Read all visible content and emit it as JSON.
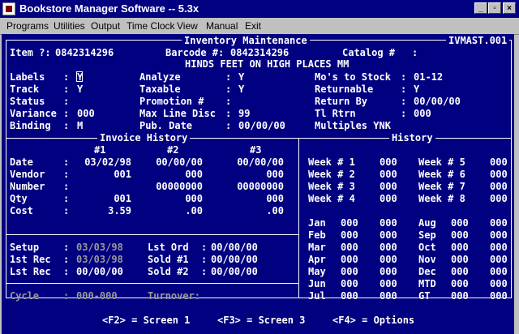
{
  "window": {
    "title": "Bookstore Manager Software -- 5.3x",
    "controls": {
      "minimize": "_",
      "maximize": "▫",
      "close": "×"
    }
  },
  "menu": [
    "Programs",
    "Utilities",
    "Output",
    "Time Clock",
    "View",
    "Manual",
    "Exit"
  ],
  "header": {
    "screen_title": "Inventory Maintenance",
    "screen_code": "IVMAST.001",
    "item_label": "Item ?:",
    "item_value": "0842314296",
    "barcode_label": "Barcode #:",
    "barcode_value": "0842314296",
    "catalog_label": "Catalog #",
    "catalog_value": ":",
    "book_title": "HINDS FEET ON HIGH PLACES MM"
  },
  "fields": {
    "labels": {
      "label": "Labels",
      "value": "Y"
    },
    "track": {
      "label": "Track",
      "value": "Y"
    },
    "status": {
      "label": "Status",
      "value": ""
    },
    "variance": {
      "label": "Variance",
      "value": "000"
    },
    "binding": {
      "label": "Binding",
      "value": "M"
    },
    "analyze": {
      "label": "Analyze",
      "value": "Y"
    },
    "taxable": {
      "label": "Taxable",
      "value": "Y"
    },
    "promotion": {
      "label": "Promotion #",
      "value": ""
    },
    "max_line_disc": {
      "label": "Max Line Disc",
      "value": "99"
    },
    "pub_date": {
      "label": "Pub. Date",
      "value": "00/00/00"
    },
    "mos_to_stock": {
      "label": "Mo's to Stock",
      "value": "01-12"
    },
    "returnable": {
      "label": "Returnable",
      "value": "Y"
    },
    "return_by": {
      "label": "Return By",
      "value": "00/00/00"
    },
    "tl_rtrn": {
      "label": "Tl Rtrn",
      "value": "000"
    },
    "multiples": {
      "label": "Multiples YNK",
      "value": ""
    }
  },
  "invoice_history": {
    "title": "Invoice History",
    "columns": [
      "#1",
      "#2",
      "#3"
    ],
    "rows": [
      {
        "label": "Date",
        "values": [
          "03/02/98",
          "00/00/00",
          "00/00/00"
        ]
      },
      {
        "label": "Vendor",
        "values": [
          "001",
          "000",
          "000"
        ]
      },
      {
        "label": "Number",
        "values": [
          "",
          "00000000",
          "00000000"
        ]
      },
      {
        "label": "Qty",
        "values": [
          "001",
          "000",
          "000"
        ]
      },
      {
        "label": "Cost",
        "values": [
          "3.59",
          ".00",
          ".00"
        ]
      }
    ]
  },
  "setup": {
    "setup": {
      "label": "Setup",
      "value": "03/03/98"
    },
    "first_rec": {
      "label": "1st Rec",
      "value": "03/03/98"
    },
    "last_rec": {
      "label": "Lst Rec",
      "value": "00/00/00"
    },
    "last_ord": {
      "label": "Lst Ord",
      "value": "00/00/00"
    },
    "sold_1": {
      "label": "Sold #1",
      "value": "00/00/00"
    },
    "sold_2": {
      "label": "Sold #2",
      "value": "00/00/00"
    }
  },
  "cycle": {
    "label": "Cycle",
    "value": "000-000",
    "turnover_label": "Turnover:"
  },
  "history": {
    "title": "History",
    "weeks_left": [
      {
        "label": "Week # 1",
        "value": "000"
      },
      {
        "label": "Week # 2",
        "value": "000"
      },
      {
        "label": "Week # 3",
        "value": "000"
      },
      {
        "label": "Week # 4",
        "value": "000"
      }
    ],
    "weeks_right": [
      {
        "label": "Week # 5",
        "value": "000"
      },
      {
        "label": "Week # 6",
        "value": "000"
      },
      {
        "label": "Week # 7",
        "value": "000"
      },
      {
        "label": "Week # 8",
        "value": "000"
      }
    ],
    "months_left": [
      {
        "label": "Jan",
        "values": [
          "000",
          "000"
        ]
      },
      {
        "label": "Feb",
        "values": [
          "000",
          "000"
        ]
      },
      {
        "label": "Mar",
        "values": [
          "000",
          "000"
        ]
      },
      {
        "label": "Apr",
        "values": [
          "000",
          "000"
        ]
      },
      {
        "label": "May",
        "values": [
          "000",
          "000"
        ]
      },
      {
        "label": "Jun",
        "values": [
          "000",
          "000"
        ]
      },
      {
        "label": "Jul",
        "values": [
          "000",
          "000"
        ]
      }
    ],
    "months_right": [
      {
        "label": "Aug",
        "values": [
          "000",
          "000"
        ]
      },
      {
        "label": "Sep",
        "values": [
          "000",
          "000"
        ]
      },
      {
        "label": "Oct",
        "values": [
          "000",
          "000"
        ]
      },
      {
        "label": "Nov",
        "values": [
          "000",
          "000"
        ]
      },
      {
        "label": "Dec",
        "values": [
          "000",
          "000"
        ]
      },
      {
        "label": "MTD",
        "values": [
          "000",
          "000"
        ]
      },
      {
        "label": "GT",
        "values": [
          "000",
          "000"
        ]
      }
    ]
  },
  "footer": {
    "f2": "<F2> = Screen 1",
    "f3": "<F3> = Screen 3",
    "f4": "<F4> = Options"
  },
  "colors": {
    "screen_bg": "#000080",
    "text": "#ffffff",
    "dim_text": "#9a9a9a",
    "titlebar": "#000080",
    "chrome": "#c0c0c0"
  }
}
